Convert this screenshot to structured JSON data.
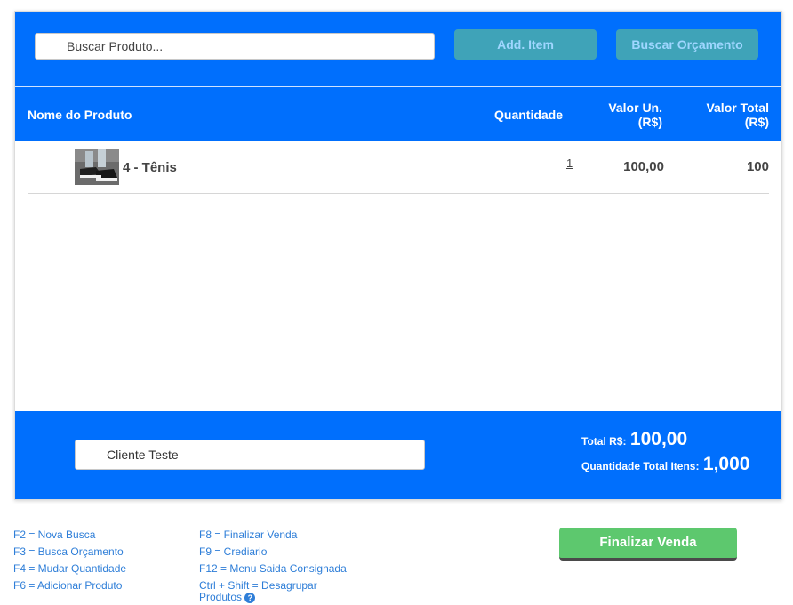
{
  "toolbar": {
    "search_placeholder": "Buscar Produto...",
    "add_item_label": "Add. Item",
    "search_budget_label": "Buscar Orçamento"
  },
  "table": {
    "columns": {
      "name": "Nome do Produto",
      "quantity": "Quantidade",
      "unit_value_line1": "Valor Un.",
      "unit_value_line2": "(R$)",
      "total_value_line1": "Valor Total",
      "total_value_line2": "(R$)"
    },
    "rows": [
      {
        "name": "4 - Tênis",
        "quantity": "1",
        "unit_value": "100,00",
        "total_value": "100"
      }
    ]
  },
  "footer": {
    "client_value": "Cliente Teste",
    "total_label": "Total R$:",
    "total_value": "100,00",
    "qty_total_label": "Quantidade Total Itens:",
    "qty_total_value": "1,000"
  },
  "shortcuts": {
    "col1": [
      "F2 = Nova Busca",
      "F3 = Busca Orçamento",
      "F4 = Mudar Quantidade",
      "F6 = Adicionar Produto"
    ],
    "col2": [
      "F8 = Finalizar Venda",
      "F9 = Crediario",
      "F12 = Menu Saida Consignada"
    ],
    "col2_multi_line1": "Ctrl + Shift = Desagrupar",
    "col2_multi_line2": "Produtos",
    "help_glyph": "?"
  },
  "actions": {
    "finish_label": "Finalizar Venda"
  },
  "colors": {
    "brand_blue": "#006ffd",
    "teal_button": "#3fa3b8",
    "finish_green": "#5dc86e",
    "link_blue": "#2e7ed8"
  }
}
